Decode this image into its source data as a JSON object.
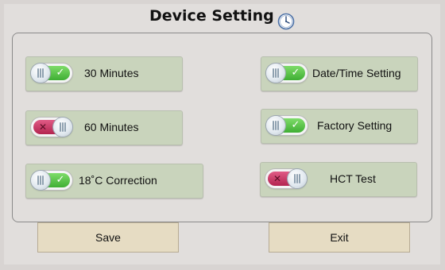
{
  "header": {
    "title": "Device Setting",
    "icon": "clock-icon"
  },
  "settings": [
    {
      "label": "30 Minutes",
      "state": "on"
    },
    {
      "label": "60 Minutes",
      "state": "off"
    },
    {
      "label": "18˚C Correction",
      "state": "on"
    },
    {
      "label": "Date/Time Setting",
      "state": "on"
    },
    {
      "label": "Factory Setting",
      "state": "on"
    },
    {
      "label": "HCT Test",
      "state": "off"
    }
  ],
  "footer": {
    "save_label": "Save",
    "exit_label": "Exit"
  },
  "colors": {
    "toggle_on": "#3fae33",
    "toggle_off": "#b3244f",
    "setting_bg": "#c9d4bc",
    "button_bg": "#e6dcc3"
  }
}
